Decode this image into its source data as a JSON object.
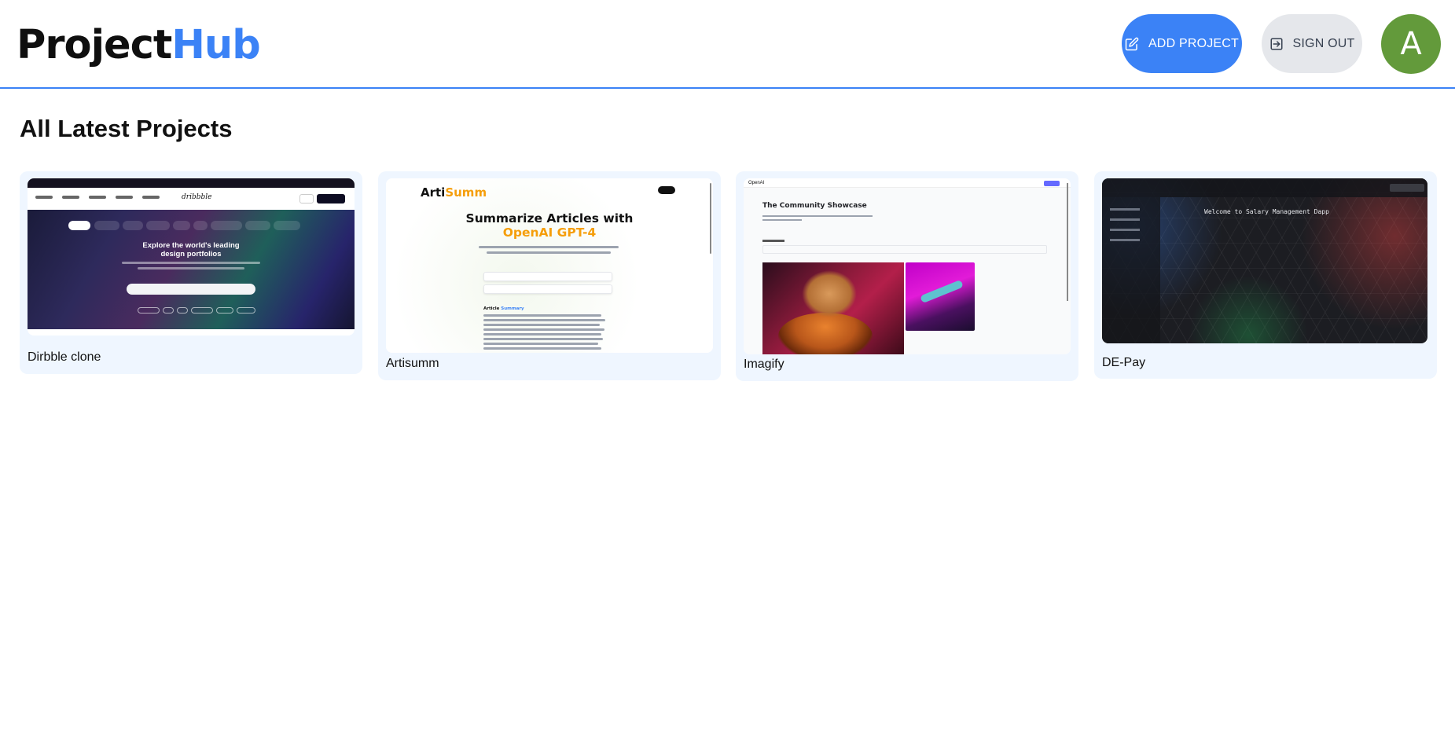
{
  "header": {
    "logo_part1": "Project",
    "logo_part2": "Hub",
    "add_project_label": "ADD PROJECT",
    "sign_out_label": "SIGN OUT",
    "avatar_letter": "A"
  },
  "main": {
    "section_title": "All Latest Projects",
    "projects": [
      {
        "title": "Dirbble clone"
      },
      {
        "title": "Artisumm"
      },
      {
        "title": "Imagify"
      },
      {
        "title": "DE-Pay"
      }
    ]
  },
  "thumbnails": {
    "dribbble": {
      "hero_heading": "Explore the world's leading design portfolios"
    },
    "artisumm": {
      "logo_a": "Arti",
      "logo_b": "Summ",
      "heading_a": "Summarize Articles with",
      "heading_b": "OpenAI GPT-4",
      "section_a": "Article ",
      "section_b": "Summary"
    },
    "imagify": {
      "brand": "OpenAI",
      "heading": "The Community Showcase"
    },
    "depay": {
      "welcome": "Welcome to Salary Management Dapp"
    }
  },
  "colors": {
    "accent": "#3b82f6",
    "avatar": "#639a3b",
    "card_bg": "#eff6ff",
    "signout_bg": "#e5e7eb"
  },
  "icons": {
    "add_project": "edit-icon",
    "sign_out": "logout-icon"
  }
}
